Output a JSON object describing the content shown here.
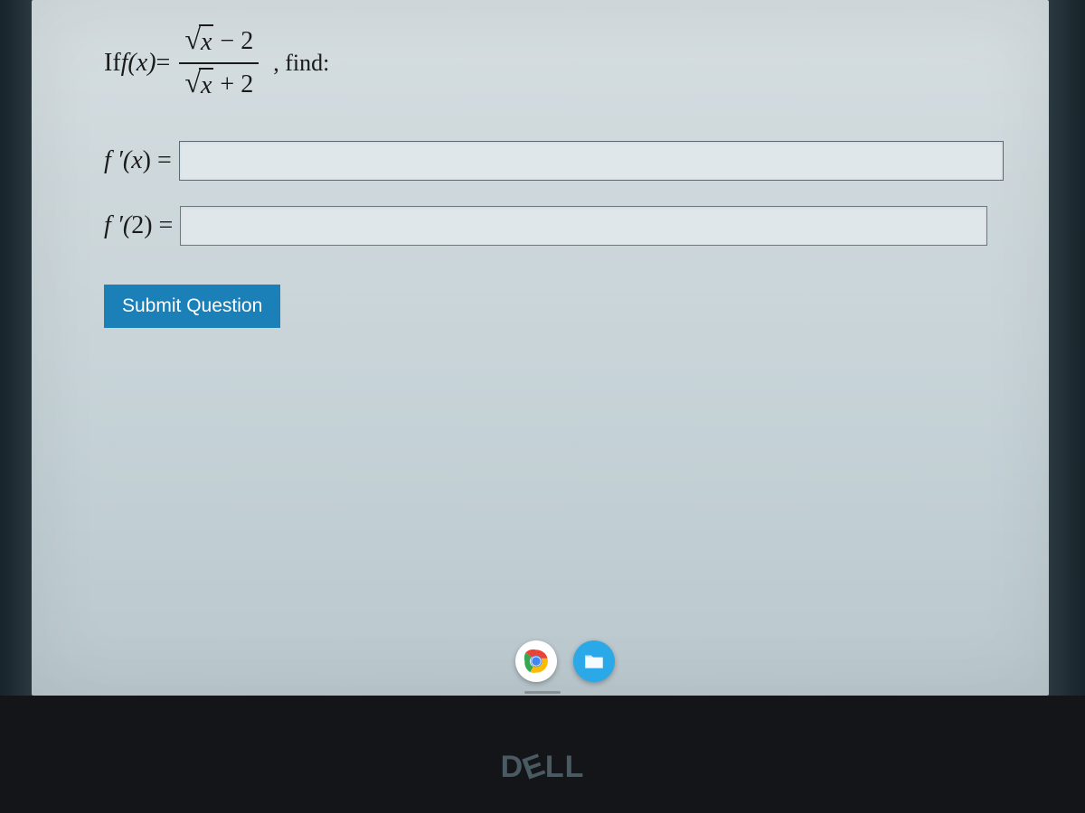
{
  "question": {
    "prefix_if": "If ",
    "fx": "f(x)",
    "equals": " = ",
    "numerator_sqrt_var": "x",
    "numerator_op": " − 2",
    "denominator_sqrt_var": "x",
    "denominator_op": " + 2",
    "comma_find": ", find:"
  },
  "answers": [
    {
      "label_prefix": "f ′(",
      "label_arg": "x",
      "label_suffix": ") =",
      "value": "",
      "placeholder": ""
    },
    {
      "label_prefix": "f ′(",
      "label_arg": "2",
      "label_suffix": ") =",
      "value": "",
      "placeholder": ""
    }
  ],
  "submit": {
    "label": "Submit Question"
  },
  "taskbar": {
    "chrome": "chrome-icon",
    "files": "files-icon"
  },
  "logo": {
    "d": "D",
    "e": "E",
    "ll": "LL"
  }
}
